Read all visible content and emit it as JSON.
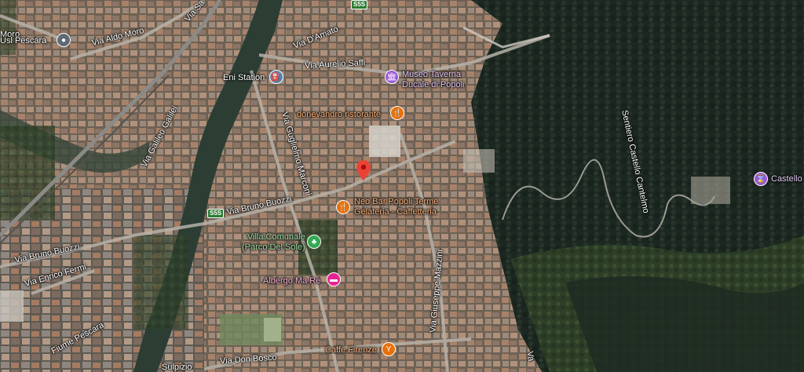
{
  "map": {
    "type": "satellite",
    "roads": {
      "via_aldo_moro": "Via Aldo Moro",
      "via_damato": "Via D'Amato",
      "via_aurelio_saffi": "Via Aurelio Saffi",
      "via_galileo_galilei": "Via Galileo Galilei",
      "via_guglielmo_marconi": "Via Guglielmo Marconi",
      "via_bruno_buozzi_main": "Via Bruno Buozzi",
      "via_bruno_buozzi_west": "Via Bruno Buozzi",
      "via_enrico_fermi": "Via Enrico Fermi",
      "via_giuseppe_mazzini": "Via Giuseppe Mazzini",
      "via_don_bosco": "Via Don Bosco",
      "sentiero": "Sentiero Castello Cantelmo",
      "fiume_pescara": "Fiume Pescara",
      "via_sulpizio": "Sulpizio",
      "via_sa": "Via Sa",
      "moro_edge": "Moro",
      "va_edge": "Va"
    },
    "route_shields": {
      "s5_top": "S5S",
      "s5_mid": "S5S"
    },
    "pois": {
      "usl": "Usl Pescara",
      "eni": "Eni Station",
      "museo": "Museo Taverna\nDucale di Popoli",
      "donevandro": "donevandro ristorante",
      "neo_bar": "Neo Bar Popoli Terme\nGelateria - Caffetteria",
      "villa": "Villa Comunale\n(Parco Del Sole)",
      "albergo": "Albergo Ma Re",
      "caffe": "Caffe Firenze",
      "castello": "Castello"
    },
    "colors": {
      "restaurant": "#e8710a",
      "museum": "#9b59d6",
      "park": "#34a853",
      "hotel": "#e52592",
      "gas": "#5e7ea8",
      "marker": "#ea4335"
    },
    "icons": {
      "usl": "medical-icon",
      "eni": "gas-station-icon",
      "museo": "museum-icon",
      "donevandro": "restaurant-icon",
      "neo_bar": "restaurant-icon",
      "villa": "park-icon",
      "albergo": "hotel-icon",
      "caffe": "bar-icon",
      "castello": "landmark-icon",
      "marker": "location-pin-icon"
    }
  }
}
